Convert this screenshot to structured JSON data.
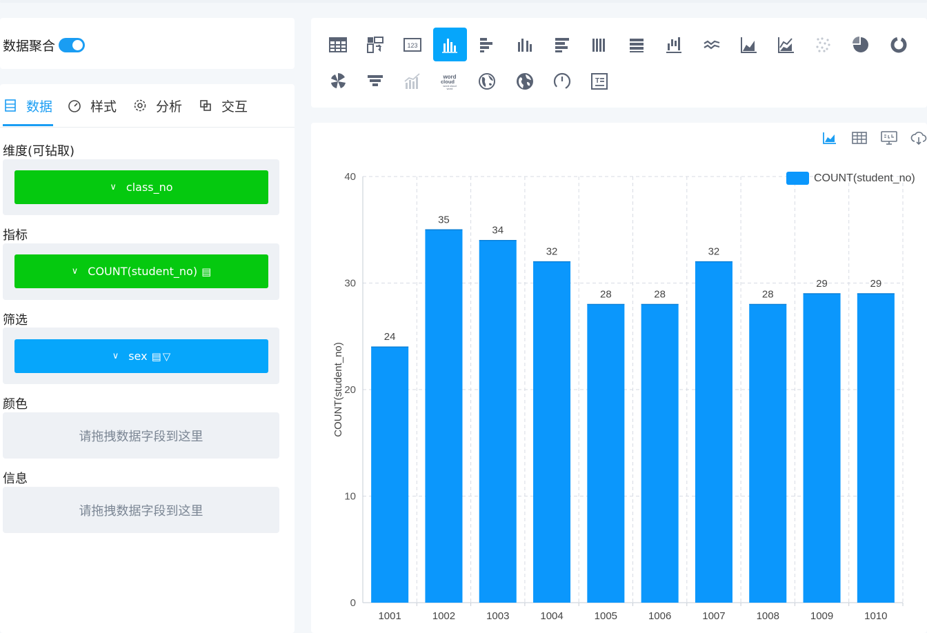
{
  "aggregation": {
    "label": "数据聚合",
    "enabled": true
  },
  "tabs": [
    {
      "label": "数据",
      "icon": "data-icon",
      "active": true
    },
    {
      "label": "样式",
      "icon": "dashboard-icon",
      "active": false
    },
    {
      "label": "分析",
      "icon": "gear-icon",
      "active": false
    },
    {
      "label": "交互",
      "icon": "link-icon",
      "active": false
    }
  ],
  "sections": {
    "dimension": {
      "title": "维度(可钻取)",
      "field": "class_no"
    },
    "metric": {
      "title": "指标",
      "field": "COUNT(student_no)"
    },
    "filter": {
      "title": "筛选",
      "field": "sex"
    },
    "color": {
      "title": "颜色",
      "placeholder": "请拖拽数据字段到这里"
    },
    "info": {
      "title": "信息",
      "placeholder": "请拖拽数据字段到这里"
    }
  },
  "chart_types": [
    "table-icon",
    "pivot-icon",
    "number-card-icon",
    "bar-chart-icon",
    "horizontal-bar-icon",
    "grouped-bar-icon",
    "stacked-horizontal-bar-icon",
    "stacked-bar-icon",
    "percent-bar-icon",
    "waterfall-icon",
    "line-chart-icon",
    "area-chart-icon",
    "stacked-area-icon",
    "scatter-icon",
    "pie-chart-icon",
    "donut-chart-icon",
    "rose-chart-icon",
    "funnel-icon",
    "combo-chart-icon",
    "word-cloud-icon",
    "map-icon",
    "world-map-icon",
    "gauge-icon",
    "text-icon"
  ],
  "toolbar": [
    "chart-view-icon",
    "table-view-icon",
    "sql-icon",
    "download-icon"
  ],
  "colors": {
    "accent": "#1a9df3",
    "bar": "#0b97fc",
    "green": "#05c90f"
  },
  "chart_data": {
    "type": "bar",
    "categories": [
      "1001",
      "1002",
      "1003",
      "1004",
      "1005",
      "1006",
      "1007",
      "1008",
      "1009",
      "1010"
    ],
    "series": [
      {
        "name": "COUNT(student_no)",
        "values": [
          24,
          35,
          34,
          32,
          28,
          28,
          32,
          28,
          29,
          29
        ]
      }
    ],
    "ylabel": "COUNT(student_no)",
    "ylim": [
      0,
      40
    ],
    "yticks": [
      0,
      10,
      20,
      30,
      40
    ],
    "grid": true,
    "legend": "top-right",
    "data_labels": true
  }
}
